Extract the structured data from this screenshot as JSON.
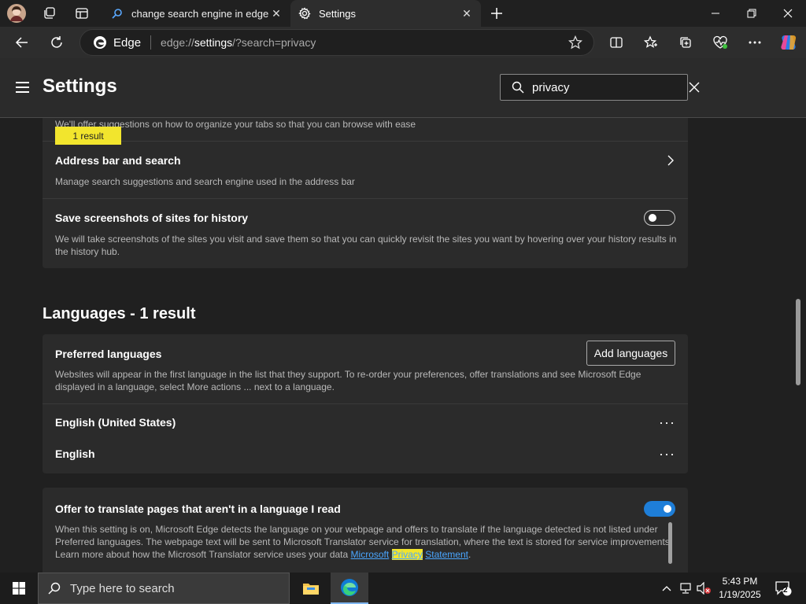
{
  "browser": {
    "tabs": [
      {
        "title": "change search engine in edge - S",
        "active": false
      },
      {
        "title": "Settings",
        "active": true
      }
    ],
    "address": {
      "brand": "Edge",
      "url_prefix": "edge://",
      "url_host": "settings",
      "url_rest": "/?search=privacy"
    }
  },
  "settings": {
    "title": "Settings",
    "search_value": "privacy",
    "badge": "1 result",
    "truncated_desc": "We'll offer suggestions on how to organize your tabs so that you can browse with ease",
    "address_bar": {
      "title": "Address bar and search",
      "desc": "Manage search suggestions and search engine used in the address bar"
    },
    "screenshots": {
      "title": "Save screenshots of sites for history",
      "desc": "We will take screenshots of the sites you visit and save them so that you can quickly revisit the sites you want by hovering over your history results in the history hub.",
      "enabled": false
    },
    "languages_heading": "Languages - 1 result",
    "preferred": {
      "title": "Preferred languages",
      "button": "Add languages",
      "desc": "Websites will appear in the first language in the list that they support. To re-order your preferences, offer translations and see Microsoft Edge displayed in a language, select More actions ... next to a language.",
      "languages": [
        "English (United States)",
        "English"
      ]
    },
    "translate": {
      "title": "Offer to translate pages that aren't in a language I read",
      "enabled": true,
      "desc": "When this setting is on, Microsoft Edge detects the language on your webpage and offers to translate if the language detected is not listed under Preferred languages. The webpage text will be sent to Microsoft Translator service for translation, where the text is stored for service improvements. Learn more about how the Microsoft Translator service uses your data",
      "link_1": "Microsoft",
      "link_hl": "Privacy",
      "link_2": "Statement",
      "period": "."
    }
  },
  "taskbar": {
    "search_placeholder": "Type here to search",
    "time": "5:43 PM",
    "date": "1/19/2025",
    "notification_count": "2"
  },
  "colors": {
    "accent": "#1e7ed8",
    "highlight": "#f2e52d"
  }
}
